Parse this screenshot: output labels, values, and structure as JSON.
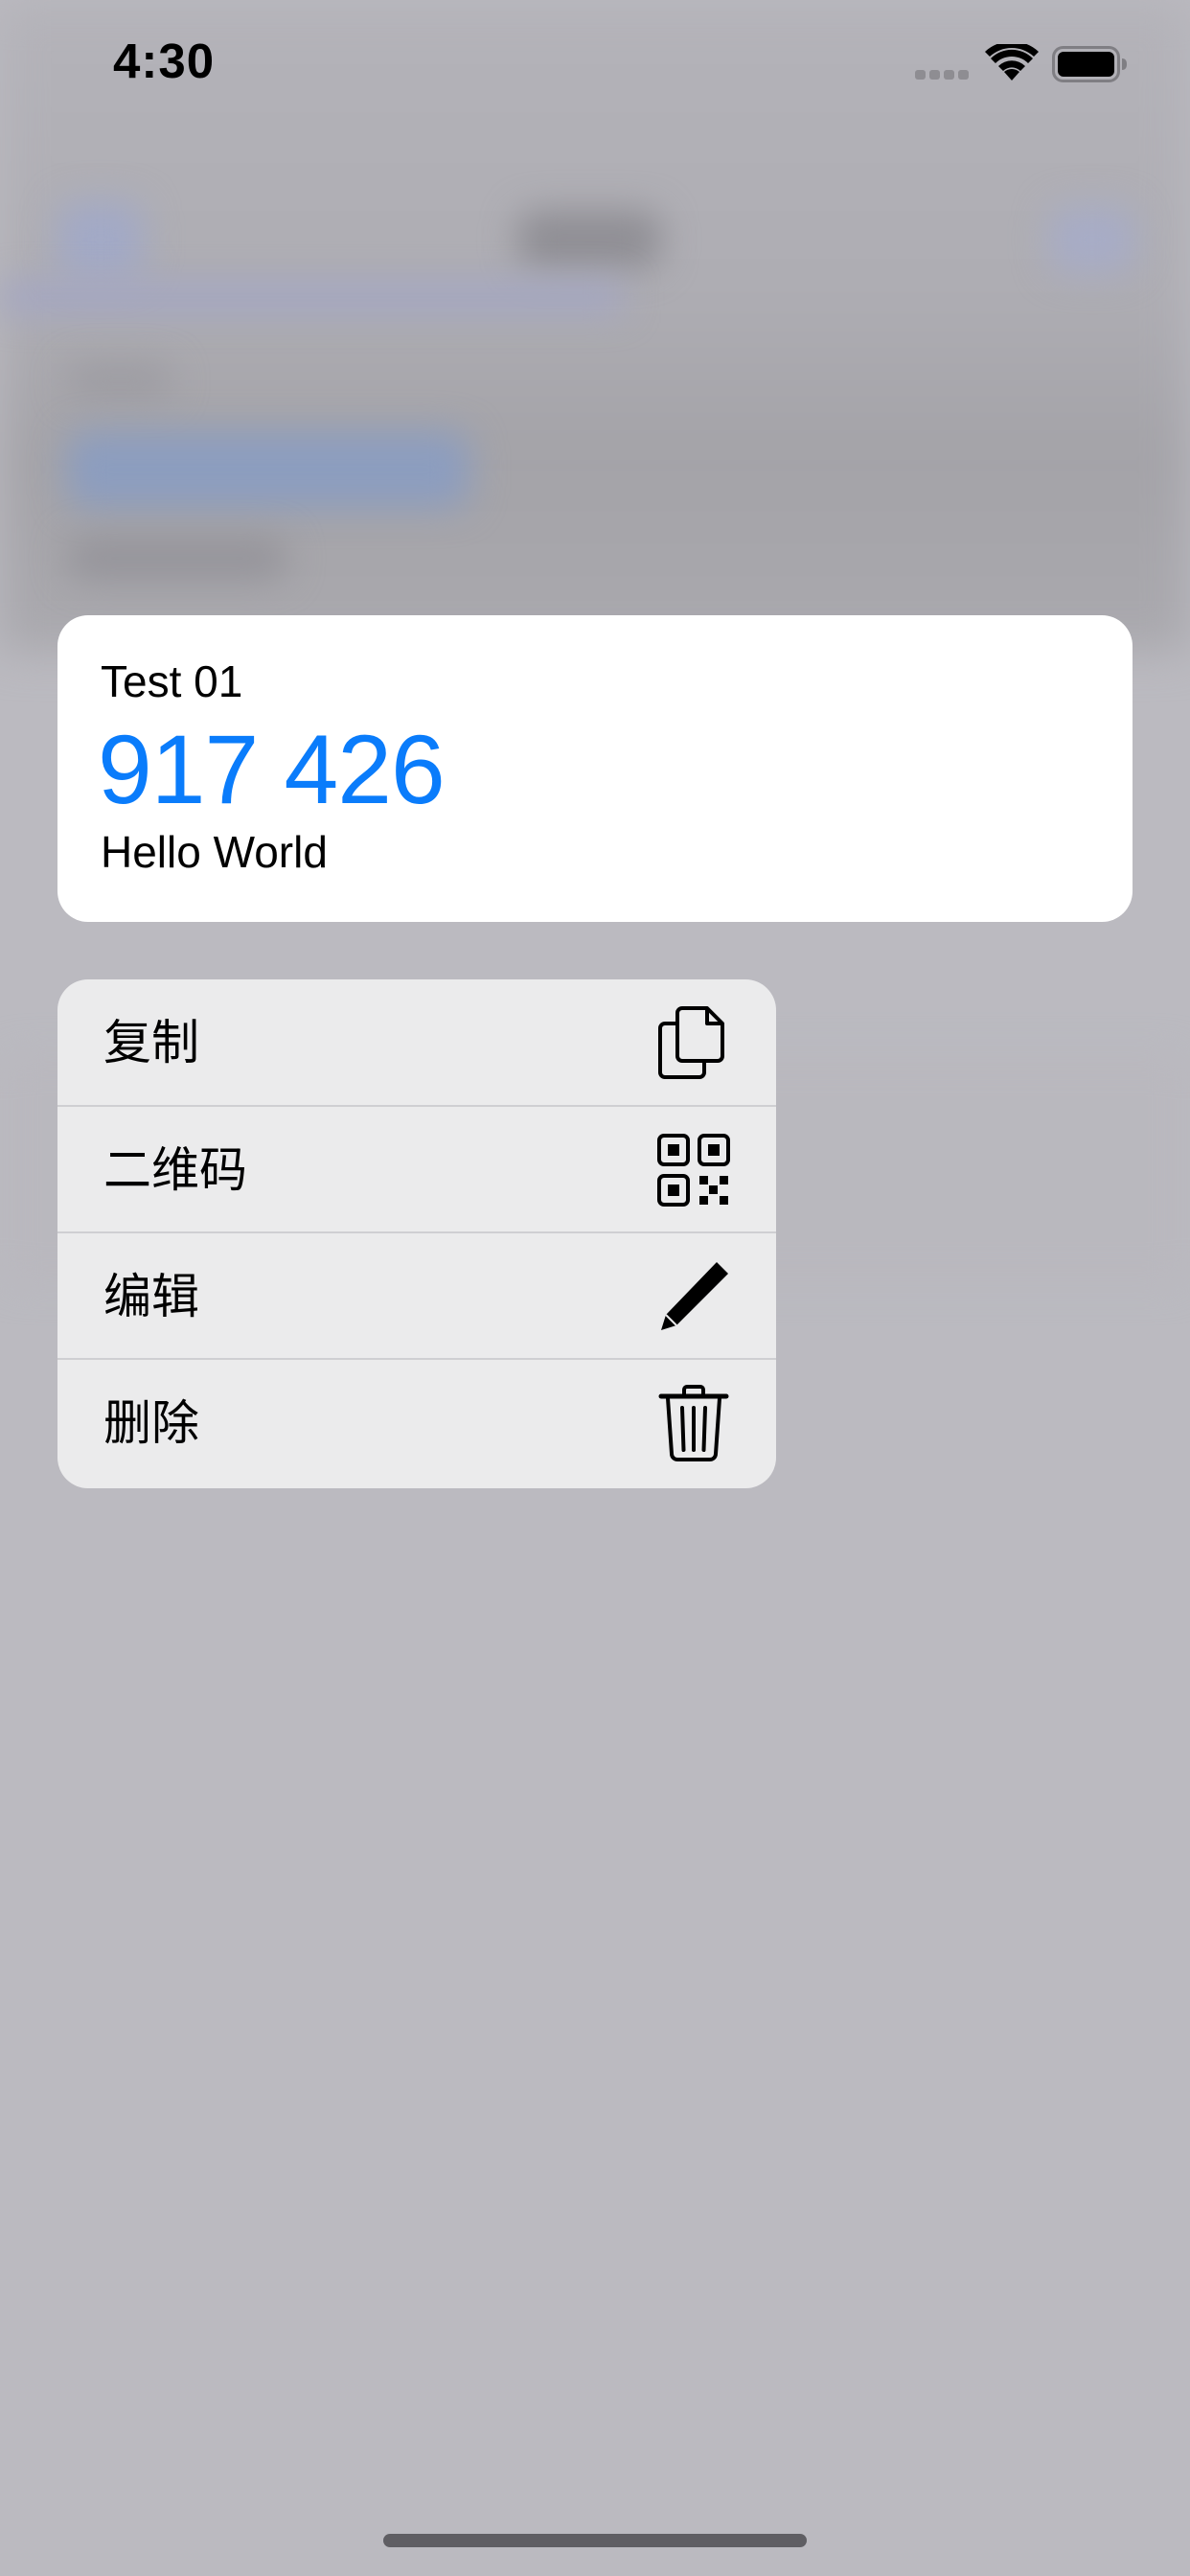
{
  "status_bar": {
    "time": "4:30",
    "icons": [
      "cellular-signal-icon",
      "wifi-icon",
      "battery-icon"
    ]
  },
  "preview_card": {
    "name": "Test 01",
    "code": "917 426",
    "note": "Hello World"
  },
  "context_menu": {
    "items": [
      {
        "label": "复制",
        "icon": "copy-icon"
      },
      {
        "label": "二维码",
        "icon": "qr-code-icon"
      },
      {
        "label": "编辑",
        "icon": "pencil-icon"
      },
      {
        "label": "删除",
        "icon": "trash-icon"
      }
    ]
  },
  "colors": {
    "accent": "#0a7cfb",
    "overlay": "#bbbac0",
    "menu_background": "#ebebec",
    "card_background": "#ffffff"
  }
}
